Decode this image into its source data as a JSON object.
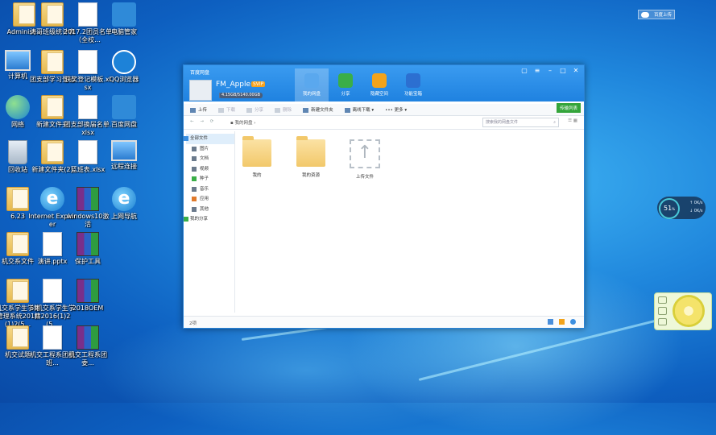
{
  "desktop": {
    "icons": [
      {
        "label": "Administ...",
        "icon": "folder-user-icon"
      },
      {
        "label": "计算机",
        "icon": "computer-icon"
      },
      {
        "label": "网络",
        "icon": "network-icon"
      },
      {
        "label": "回收站",
        "icon": "recycle-bin-icon"
      },
      {
        "label": "6.23",
        "icon": "folder-icon"
      },
      {
        "label": "机交系文件",
        "icon": "folder-icon"
      },
      {
        "label": "机交系学生学籍管理系统2016(1)2(5...",
        "icon": "folder-icon"
      },
      {
        "label": "机交试题",
        "icon": "folder-icon"
      },
      {
        "label": "涛哥班级统计表",
        "icon": "folder-icon"
      },
      {
        "label": "团支部学习登记",
        "icon": "folder-icon"
      },
      {
        "label": "新建文件夹",
        "icon": "folder-icon"
      },
      {
        "label": "新建文件夹(2)",
        "icon": "folder-icon"
      },
      {
        "label": "Internet Explorer",
        "icon": "internet-explorer-icon"
      },
      {
        "label": "演讲.pptx",
        "icon": "pptx-icon"
      },
      {
        "label": "5.机交系学生学籍2016(1)2(5...",
        "icon": "document-icon"
      },
      {
        "label": "机交工程系团委班...",
        "icon": "document-icon"
      },
      {
        "label": "2017.2团员名单（全校...",
        "icon": "document-icon"
      },
      {
        "label": "获奖登记模板.xlsx",
        "icon": "xlsx-icon"
      },
      {
        "label": "团支部换届名单.xlsx",
        "icon": "xlsx-icon"
      },
      {
        "label": "蓝班表.xlsx",
        "icon": "xlsx-icon"
      },
      {
        "label": "windows10激活",
        "icon": "winrar-icon"
      },
      {
        "label": "保护工具",
        "icon": "winrar-icon"
      },
      {
        "label": "2018OEM",
        "icon": "winrar-icon"
      },
      {
        "label": "机交工程系团委...",
        "icon": "winrar-icon"
      },
      {
        "label": "电脑管家",
        "icon": "pc-manager-icon"
      },
      {
        "label": "QQ浏览器",
        "icon": "qq-browser-icon"
      },
      {
        "label": "百度网盘",
        "icon": "baidu-netdisk-icon"
      },
      {
        "label": "远程连接",
        "icon": "remote-desktop-icon"
      },
      {
        "label": "上网导航",
        "icon": "browser-nav-icon"
      }
    ]
  },
  "top_widget": {
    "label": "百度上传"
  },
  "netdisk": {
    "app_title": "百度网盘",
    "user": {
      "name": "FM_Apple",
      "vip": "SVIP",
      "quota": "4.15GB/5140.00GB",
      "quota_used_fraction": 0.001
    },
    "tabs": [
      {
        "label": "我的网盘",
        "icon": "my-netdisk-icon",
        "color": "#3c8fe0"
      },
      {
        "label": "分享",
        "icon": "share-icon",
        "color": "#3aae48"
      },
      {
        "label": "隐藏空间",
        "icon": "lock-icon",
        "color": "#f2a31b"
      },
      {
        "label": "功能宝箱",
        "icon": "toolbox-icon",
        "color": "#2c6fd1"
      }
    ],
    "transfer_list": "传输列表",
    "toolbar": {
      "upload": "上传",
      "download": "下载",
      "share": "分享",
      "delete": "删除",
      "new_folder": "新建文件夹",
      "offline": "离线下载",
      "more": "更多"
    },
    "nav": {
      "back": "←",
      "forward": "→",
      "path": "我的网盘",
      "search_placeholder": "搜索我的网盘文件"
    },
    "sidebar": [
      {
        "label": "全部文件",
        "icon": "all-files-icon"
      },
      {
        "label": "图片",
        "icon": "image-icon"
      },
      {
        "label": "文档",
        "icon": "doc-icon"
      },
      {
        "label": "视频",
        "icon": "video-icon"
      },
      {
        "label": "种子",
        "icon": "bt-icon"
      },
      {
        "label": "音乐",
        "icon": "music-icon"
      },
      {
        "label": "应用",
        "icon": "app-icon"
      },
      {
        "label": "其他",
        "icon": "other-icon"
      },
      {
        "label": "我的分享",
        "icon": "my-share-icon"
      }
    ],
    "files": [
      {
        "label": "我的",
        "type": "folder"
      },
      {
        "label": "我的资源",
        "type": "folder"
      },
      {
        "label": "上传文件",
        "type": "upload"
      }
    ],
    "status": {
      "count": "2项"
    }
  },
  "gauge": {
    "percent": "51",
    "unit": "%",
    "up": "0K/s",
    "down": "0K/s"
  }
}
